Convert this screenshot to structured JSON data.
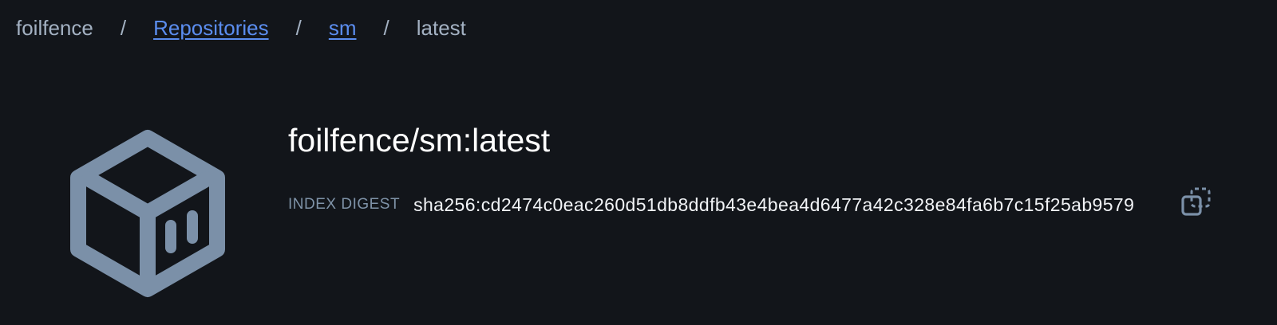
{
  "breadcrumb": {
    "items": [
      {
        "label": "foilfence"
      },
      {
        "label": "Repositories"
      },
      {
        "label": "sm"
      },
      {
        "label": "latest"
      }
    ],
    "separator": "/"
  },
  "image": {
    "title": "foilfence/sm:latest",
    "icon": "package-box-icon",
    "icon_color": "#7b90a8"
  },
  "digest": {
    "label": "INDEX DIGEST",
    "value": "sha256:cd2474c0eac260d51db8ddfb43e4bea4d6477a42c328e84fa6b7c15f25ab9579",
    "copy_icon": "copy-icon"
  },
  "colors": {
    "background": "#12151a",
    "link": "#5b8def",
    "muted_text": "#a3b1c2",
    "label_text": "#7f93a8"
  }
}
